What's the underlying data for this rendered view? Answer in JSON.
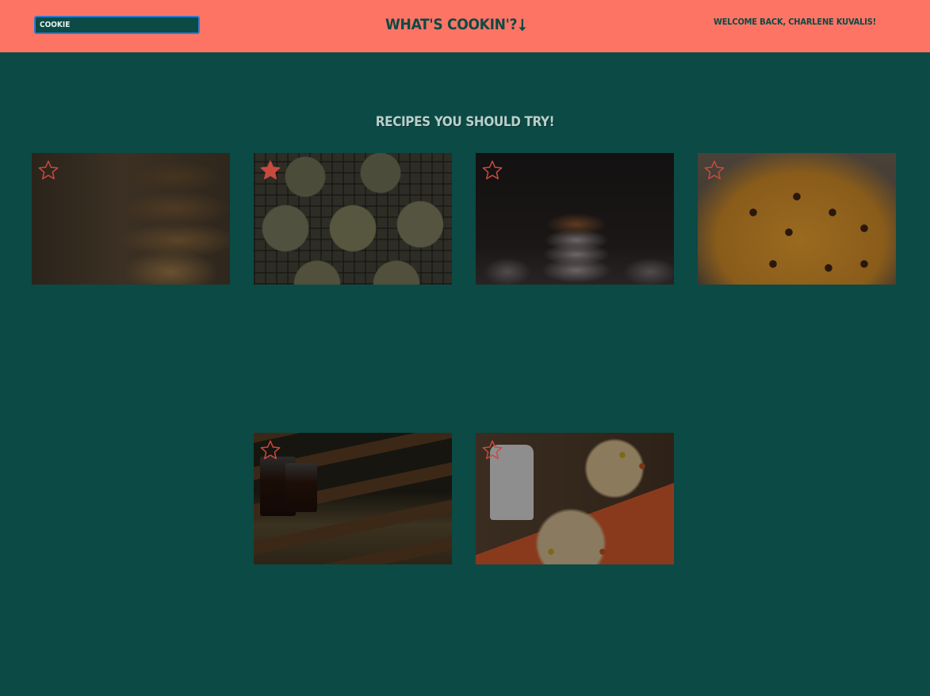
{
  "header": {
    "search_value": "COOKIE",
    "app_title": "WHAT'S COOKIN'?",
    "title_arrow": "⭣",
    "welcome": "WELCOME BACK, CHARLENE KUVALIS!"
  },
  "main": {
    "section_title": "RECIPES YOU SHOULD TRY!"
  },
  "colors": {
    "header_bg": "#fd7465",
    "page_bg": "#0c4a45",
    "star": "#c84a3f"
  },
  "cards": [
    {
      "favorited": false,
      "icon": "star-outline-icon"
    },
    {
      "favorited": true,
      "icon": "star-filled-icon"
    },
    {
      "favorited": false,
      "icon": "star-outline-icon"
    },
    {
      "favorited": false,
      "icon": "star-outline-icon"
    },
    {
      "favorited": false,
      "icon": "star-outline-icon"
    },
    {
      "favorited": false,
      "icon": "star-outline-icon"
    }
  ]
}
